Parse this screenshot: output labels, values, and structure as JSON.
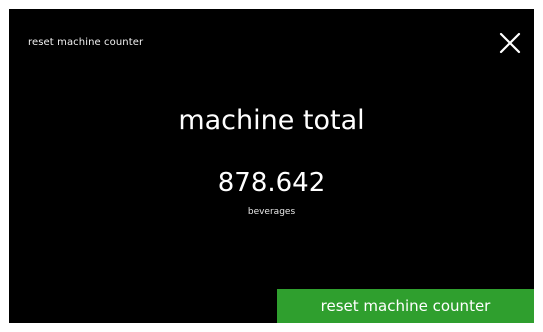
{
  "header": {
    "title": "reset machine counter",
    "close_icon": "close-icon"
  },
  "main": {
    "heading": "machine total",
    "counter_value": "878.642",
    "counter_unit": "beverages"
  },
  "footer": {
    "reset_button_label": "reset machine counter"
  },
  "colors": {
    "screen_background": "#000000",
    "text": "#ffffff",
    "button_green": "#2f9f2e"
  }
}
